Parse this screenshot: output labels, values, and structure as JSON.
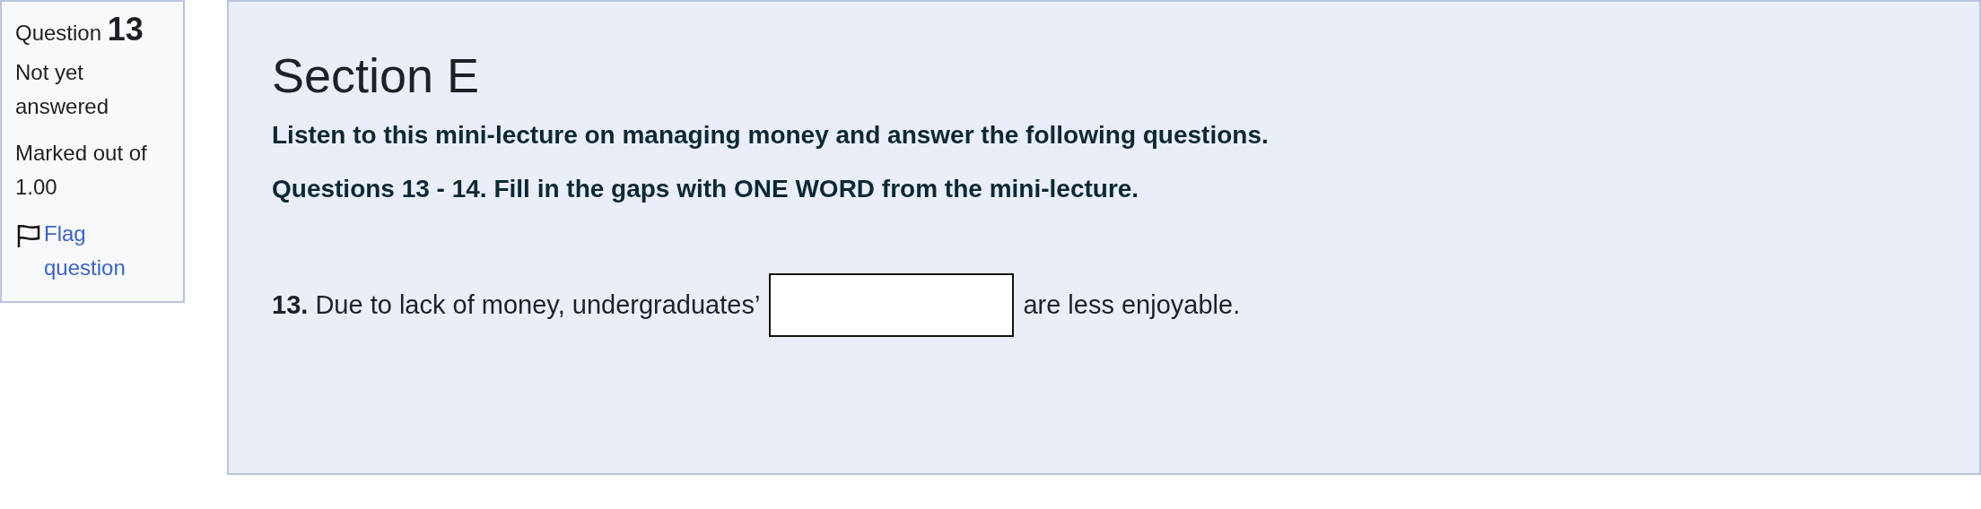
{
  "info": {
    "question_label": "Question",
    "question_number": "13",
    "status": "Not yet answered",
    "mark": "Marked out of 1.00",
    "flag": {
      "label": "Flag question",
      "flagged": false
    }
  },
  "content": {
    "title": "Section E",
    "instructions": [
      "Listen to this mini-lecture on managing money and answer the following questions.",
      "Questions 13 - 14. Fill in the gaps with ONE WORD from the mini-lecture."
    ],
    "question": {
      "number": "13.",
      "before": "Due to lack of money, undergraduates’",
      "after": "are less enjoyable."
    }
  }
}
